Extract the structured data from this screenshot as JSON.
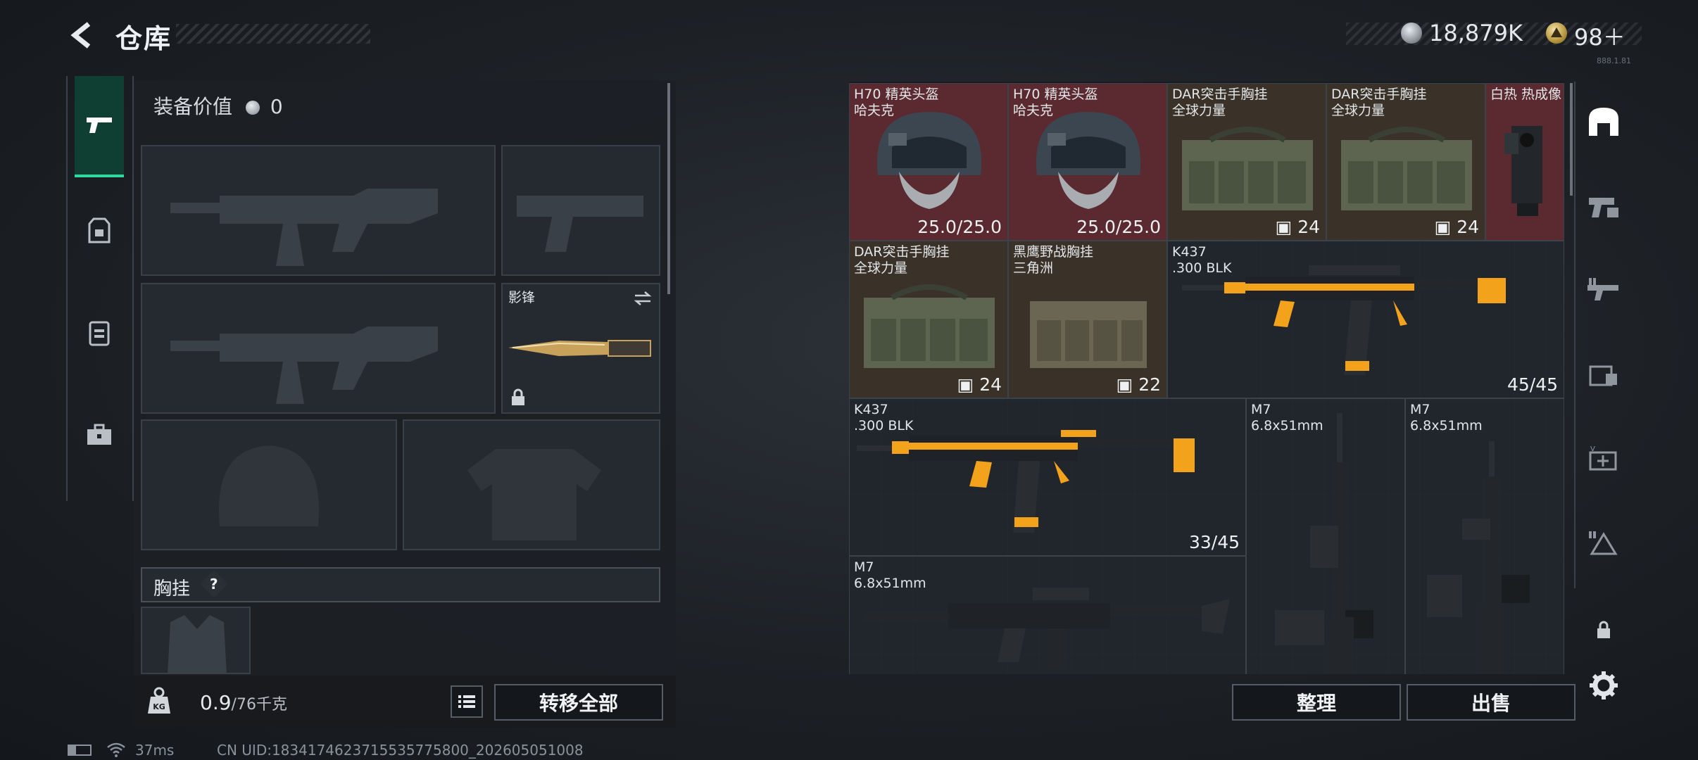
{
  "header": {
    "title": "仓库",
    "currency": "18,879K",
    "tickets": "98＋",
    "version": "888.1.81"
  },
  "equipment": {
    "value_label": "装备价值",
    "value": "0",
    "melee_name": "影锋",
    "chest_rig_label": "胸挂",
    "chest_rig_help": "?",
    "weight_current": "0.9",
    "weight_max": "/76千克",
    "transfer_all": "转移全部"
  },
  "storage": {
    "items": [
      {
        "name1": "H70 精英头盔",
        "name2": "哈夫克",
        "value": "25.0/25.0"
      },
      {
        "name1": "H70 精英头盔",
        "name2": "哈夫克",
        "value": "25.0/25.0"
      },
      {
        "name1": "DAR突击手胸挂",
        "name2": "全球力量",
        "value": "24"
      },
      {
        "name1": "DAR突击手胸挂",
        "name2": "全球力量",
        "value": "24"
      },
      {
        "name1": "白热 热成像",
        "name2": "",
        "value": ""
      },
      {
        "name1": "DAR突击手胸挂",
        "name2": "全球力量",
        "value": "24"
      },
      {
        "name1": "黑鹰野战胸挂",
        "name2": "三角洲",
        "value": "22"
      },
      {
        "name1": "K437",
        "name2": ".300 BLK",
        "value": "45/45"
      },
      {
        "name1": "K437",
        "name2": ".300 BLK",
        "value": "33/45"
      },
      {
        "name1": "M7",
        "name2": "6.8x51mm",
        "value": ""
      },
      {
        "name1": "M7",
        "name2": "6.8x51mm",
        "value": ""
      },
      {
        "name1": "M7",
        "name2": "6.8x51mm",
        "value": ""
      }
    ],
    "sort_button": "整理",
    "sell_button": "出售"
  },
  "status": {
    "ping": "37ms",
    "uid": "CN UID:1834174623715535775800_202605051008"
  },
  "colors": {
    "accent": "#2fd89d",
    "weapon_orange": "#f2a21b",
    "red_cell": "#5a2a30",
    "brown_cell": "#3a3128"
  }
}
